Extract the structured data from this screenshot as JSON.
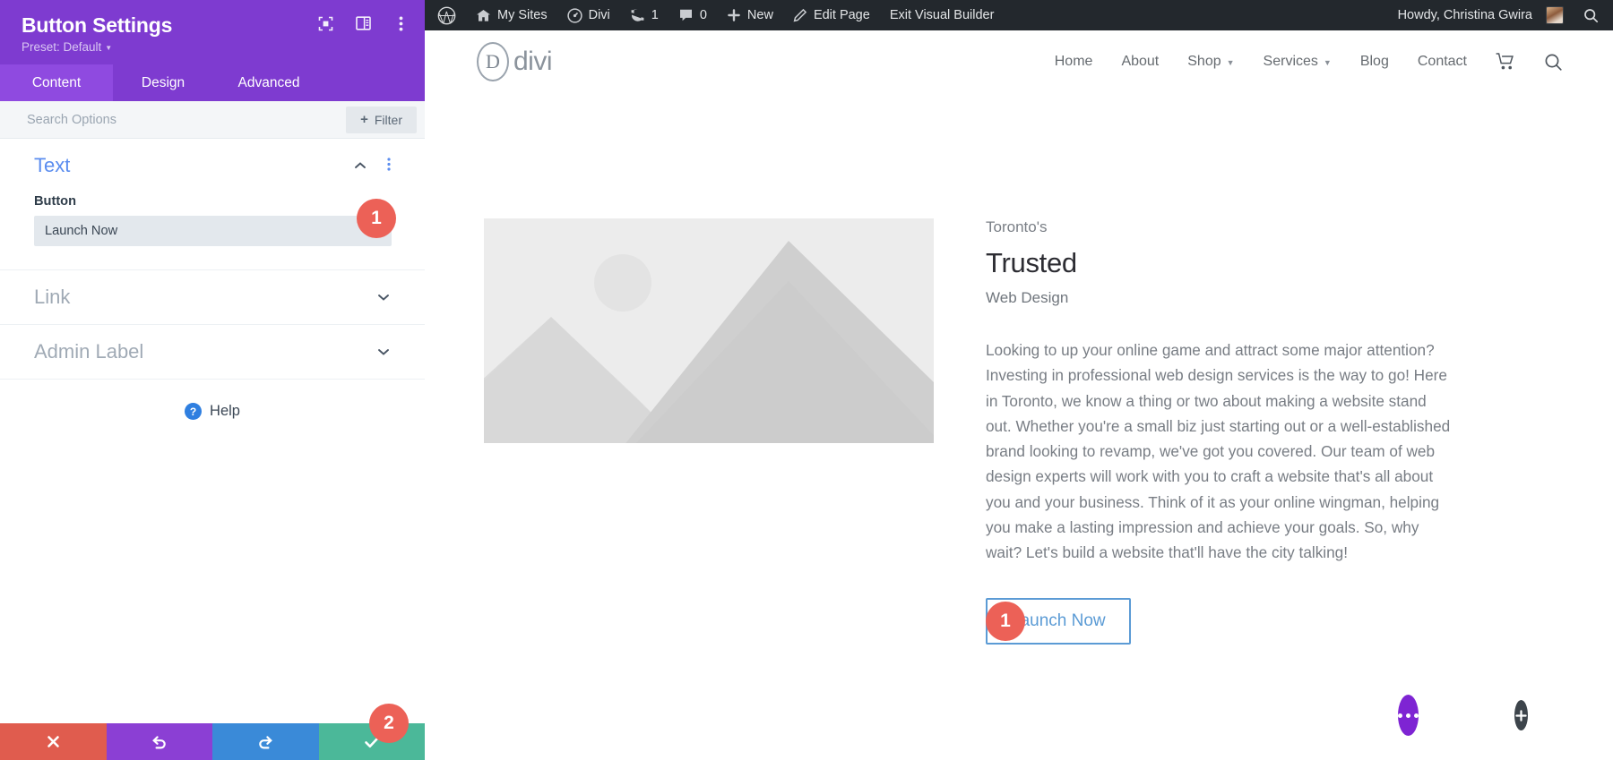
{
  "settings_panel": {
    "title": "Button Settings",
    "preset_label": "Preset: Default",
    "header_icons": [
      {
        "name": "focus-icon"
      },
      {
        "name": "layout-toggle-icon"
      },
      {
        "name": "more-options-icon"
      }
    ],
    "tabs": [
      {
        "label": "Content",
        "active": true
      },
      {
        "label": "Design",
        "active": false
      },
      {
        "label": "Advanced",
        "active": false
      }
    ],
    "search_placeholder": "Search Options",
    "filter_label": "Filter",
    "sections": [
      {
        "title": "Text",
        "state": "open",
        "fields": [
          {
            "label": "Button",
            "value": "Launch Now",
            "type": "text"
          }
        ]
      },
      {
        "title": "Link",
        "state": "closed"
      },
      {
        "title": "Admin Label",
        "state": "closed"
      }
    ],
    "help_label": "Help",
    "footer_buttons": [
      {
        "name": "cancel-button",
        "icon": "close-icon",
        "color": "#e05c4e"
      },
      {
        "name": "undo-button",
        "icon": "undo-icon",
        "color": "#8b3fd4"
      },
      {
        "name": "redo-button",
        "icon": "redo-icon",
        "color": "#3a8ad8"
      },
      {
        "name": "save-button",
        "icon": "check-icon",
        "color": "#4bb899"
      }
    ],
    "badges": [
      {
        "number": "1",
        "target": "button-text-field"
      },
      {
        "number": "2",
        "target": "save-button"
      }
    ]
  },
  "admin_bar": {
    "items": [
      {
        "label": "",
        "icon": "wordpress-logo-icon"
      },
      {
        "label": "My Sites",
        "icon": "sites-icon"
      },
      {
        "label": "Divi",
        "icon": "divi-icon"
      },
      {
        "label": "1",
        "icon": "updates-icon"
      },
      {
        "label": "0",
        "icon": "comments-icon"
      },
      {
        "label": "New",
        "icon": "plus-icon"
      },
      {
        "label": "Edit Page",
        "icon": "pencil-icon"
      },
      {
        "label": "Exit Visual Builder",
        "icon": ""
      }
    ],
    "howdy": "Howdy, Christina Gwira",
    "search_icon": "search-icon"
  },
  "site_header": {
    "logo_letter": "D",
    "logo_word": "divi",
    "nav": [
      {
        "label": "Home",
        "has_dropdown": false
      },
      {
        "label": "About",
        "has_dropdown": false
      },
      {
        "label": "Shop",
        "has_dropdown": true
      },
      {
        "label": "Services",
        "has_dropdown": true
      },
      {
        "label": "Blog",
        "has_dropdown": false
      },
      {
        "label": "Contact",
        "has_dropdown": false
      }
    ],
    "cart_icon": "cart-icon",
    "search_icon": "search-icon"
  },
  "content": {
    "eyebrow": "Toronto's",
    "headline": "Trusted",
    "subline": "Web Design",
    "paragraph": "Looking to up your online game and attract some major attention? Investing in professional web design services is the way to go! Here in Toronto, we know a thing or two about making a website stand out. Whether you're a small biz just starting out or a well-established brand looking to revamp, we've got you covered. Our team of web design experts will work with you to craft a website that's all about you and your business. Think of it as your online wingman, helping you make a lasting impression and achieve your goals. So, why wait? Let's build a website that'll have the city talking!",
    "cta_label": "Launch Now",
    "cta_badge": "1",
    "image_alt": "placeholder-image"
  },
  "floating_actions": [
    {
      "name": "section-settings-fab",
      "icon": "ellipsis-icon"
    },
    {
      "name": "add-row-fab",
      "icon": "plus-icon"
    },
    {
      "name": "add-section-fab",
      "icon": "plus-icon"
    }
  ],
  "colors": {
    "panel_purple": "#7e3bd0",
    "tab_active": "#8f4ae0",
    "badge_red": "#ec6157",
    "accent_blue": "#5b8def",
    "cta_blue": "#5b9bd5",
    "admin_bar": "#23282d"
  }
}
